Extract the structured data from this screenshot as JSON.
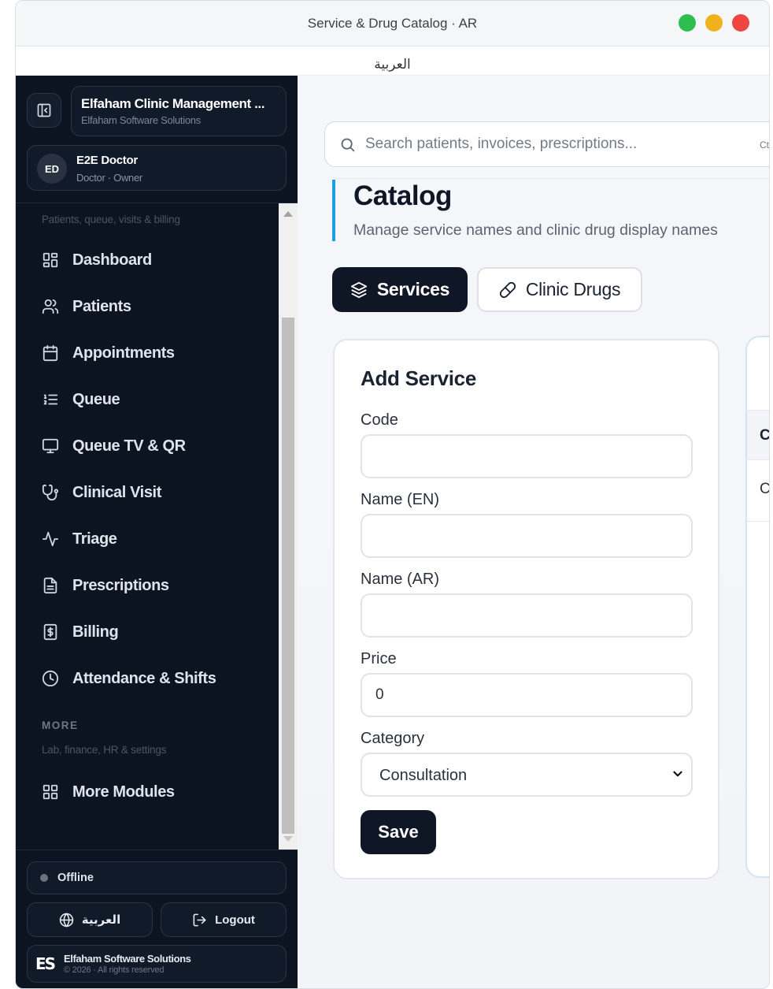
{
  "window": {
    "title": "Service & Drug Catalog · AR",
    "language_label": "العربية"
  },
  "sidebar": {
    "brand_name": "Elfaham Clinic Management ...",
    "brand_sub": "Elfaham Software Solutions",
    "user": {
      "initials": "ED",
      "name": "E2E Doctor",
      "role": "Doctor · Owner"
    },
    "section_hint": "Patients, queue, visits & billing",
    "items": [
      {
        "label": "Dashboard",
        "icon": "grid-icon"
      },
      {
        "label": "Patients",
        "icon": "users-icon"
      },
      {
        "label": "Appointments",
        "icon": "calendar-icon"
      },
      {
        "label": "Queue",
        "icon": "list-ordered-icon"
      },
      {
        "label": "Queue TV & QR",
        "icon": "monitor-icon"
      },
      {
        "label": "Clinical Visit",
        "icon": "stethoscope-icon"
      },
      {
        "label": "Triage",
        "icon": "activity-icon"
      },
      {
        "label": "Prescriptions",
        "icon": "file-text-icon"
      },
      {
        "label": "Billing",
        "icon": "receipt-icon"
      },
      {
        "label": "Attendance & Shifts",
        "icon": "clock-icon"
      }
    ],
    "more_heading": "MORE",
    "more_hint": "Lab, finance, HR & settings",
    "more_item": {
      "label": "More Modules",
      "icon": "grid-icon"
    },
    "status": "Offline",
    "lang_button": "العربية",
    "logout_button": "Logout",
    "footer_logo": "ES",
    "footer_name": "Elfaham Software Solutions",
    "footer_copy": "© 2026 · All rights reserved"
  },
  "main": {
    "search_placeholder": "Search patients, invoices, prescriptions...",
    "search_shortcut": "Ct",
    "title": "Catalog",
    "subtitle": "Manage service names and clinic drug display names",
    "tabs": [
      {
        "label": "Services",
        "active": true
      },
      {
        "label": "Clinic Drugs",
        "active": false
      }
    ],
    "form": {
      "title": "Add Service",
      "code_label": "Code",
      "code_value": "",
      "name_en_label": "Name (EN)",
      "name_en_value": "",
      "name_ar_label": "Name (AR)",
      "name_ar_value": "",
      "price_label": "Price",
      "price_value": "0",
      "category_label": "Category",
      "category_value": "Consultation",
      "save_label": "Save"
    },
    "list_card": {
      "header_text": "C",
      "row_text": "C"
    }
  },
  "colors": {
    "sidebar_bg": "#0c1422",
    "accent": "#1aa0e0",
    "primary_dark": "#0f1726",
    "traffic_green": "#2ebd4e",
    "traffic_yellow": "#f0b21b",
    "traffic_red": "#ee4444"
  }
}
